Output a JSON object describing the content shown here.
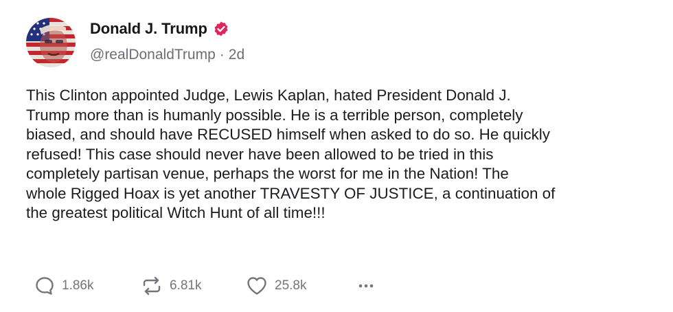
{
  "author": {
    "display_name": "Donald J. Trump",
    "handle": "@realDonaldTrump",
    "separator": "·",
    "time_ago": "2d",
    "verified_badge_color": "#e0245e",
    "avatar_icon": "flag-portrait-avatar"
  },
  "post": {
    "lines": [
      "This Clinton appointed Judge, Lewis Kaplan, hated President Donald J.",
      "Trump more than is humanly possible. He is a terrible person, completely",
      "biased, and should have RECUSED himself when asked to do so. He quickly",
      "refused! This case should never have been allowed to be tried in this",
      "completely partisan venue, perhaps the worst for me in the Nation! The",
      "whole Rigged Hoax is yet another TRAVESTY OF JUSTICE, a continuation of",
      "the greatest political Witch Hunt of all time!!!"
    ]
  },
  "actions": {
    "reply_icon": "speech-bubble-icon",
    "reply_count": "1.86k",
    "retruth_icon": "repost-arrows-icon",
    "retruth_count": "6.81k",
    "like_icon": "heart-icon",
    "like_count": "25.8k",
    "more_icon": "ellipsis-icon"
  },
  "colors": {
    "text": "#1b1b20",
    "muted": "#6c6c78",
    "accent": "#e0245e"
  }
}
